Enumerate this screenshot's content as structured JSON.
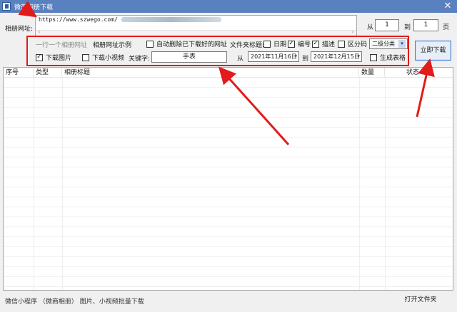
{
  "window": {
    "title": "微商相册下载",
    "close_glyph": "✕"
  },
  "url": {
    "label": "相册网址:",
    "value": "https://www.szwego.com/",
    "scroll_left": "‹",
    "scroll_right": "›"
  },
  "pages": {
    "from_label": "从",
    "from_value": "1",
    "to_label": "到",
    "to_value": "1",
    "unit": "页"
  },
  "options": {
    "one_per_line": "一行一个相册网址",
    "example": "相册网址示例",
    "auto_delete": {
      "label": "自动删除已下载好的网址",
      "checked": false
    },
    "folder_title_label": "文件夹标题:",
    "date": {
      "label": "日期",
      "checked": false
    },
    "number": {
      "label": "编号",
      "checked": true
    },
    "describe": {
      "label": "描述",
      "checked": true
    },
    "partition": {
      "label": "区分码",
      "checked": false
    },
    "category_select": "二级分类",
    "download_images": {
      "label": "下载图片",
      "checked": true
    },
    "download_videos": {
      "label": "下载小视频",
      "checked": false
    },
    "keyword_label": "关键字:",
    "keyword_value": "手表",
    "date_from_label": "从",
    "date_from": "2021年11月16日",
    "date_to_label": "到",
    "date_to": "2021年12月15日",
    "generate_table": {
      "label": "生成表格",
      "checked": false
    },
    "check_glyph": "✓"
  },
  "buttons": {
    "download_now": "立即下载",
    "open_folder": "打开文件夹"
  },
  "table": {
    "columns": [
      "序号",
      "类型",
      "相册标题",
      "数量",
      "状态"
    ]
  },
  "footer": {
    "note": "微信小程序 （微商相册） 图片、小视频批量下载"
  },
  "colors": {
    "titlebar": "#5a81bf",
    "highlight_red": "#e21b1b",
    "button_border": "#3b7ad9"
  }
}
